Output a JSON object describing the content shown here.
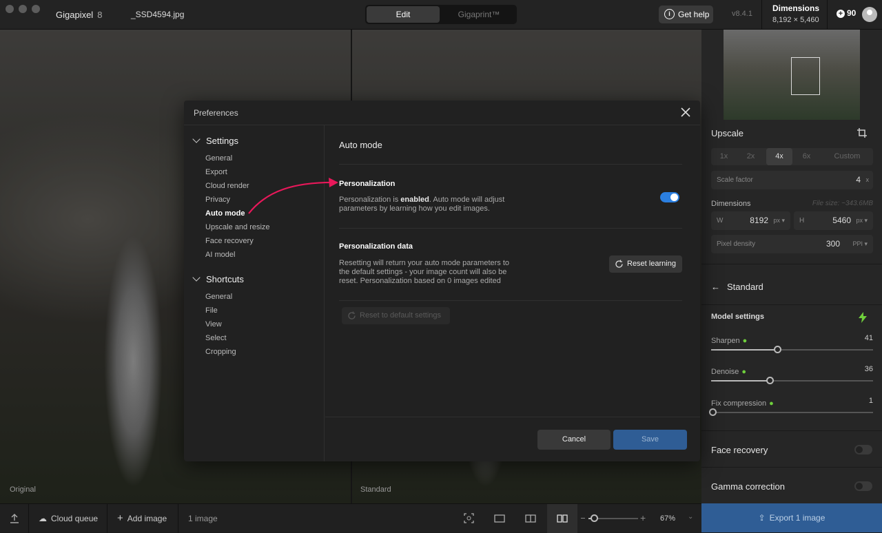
{
  "titlebar": {
    "app_name": "Gigapixel",
    "app_version": "8",
    "file_name": "_SSD4594.jpg",
    "tabs": [
      "Edit",
      "Gigaprint™"
    ],
    "help_label": "Get help",
    "version": "v8.4.1",
    "dimensions_label": "Dimensions",
    "dimensions_value": "8,192 × 5,460",
    "credits": "90"
  },
  "viewer": {
    "left_label": "Original",
    "right_label": "Standard"
  },
  "right_panel": {
    "upscale_title": "Upscale",
    "scale_options": [
      "1x",
      "2x",
      "4x",
      "6x",
      "Custom"
    ],
    "scale_selected": "4x",
    "scale_factor_label": "Scale factor",
    "scale_factor_value": "4",
    "scale_factor_unit": "x",
    "dimensions_title": "Dimensions",
    "file_size": "File size: ~343.6MB",
    "width_label": "W",
    "width_value": "8192",
    "height_label": "H",
    "height_value": "5460",
    "px_unit": "px",
    "density_label": "Pixel density",
    "density_value": "300",
    "density_unit": "PPI",
    "model_name": "Standard",
    "model_settings_title": "Model settings",
    "sliders": [
      {
        "label": "Sharpen",
        "value": "41",
        "fraction": 0.41
      },
      {
        "label": "Denoise",
        "value": "36",
        "fraction": 0.36
      },
      {
        "label": "Fix compression",
        "value": "1",
        "fraction": 0.01
      }
    ],
    "face_recovery": "Face recovery",
    "gamma_correction": "Gamma correction",
    "export_label": "Export 1 image"
  },
  "bottombar": {
    "cloud_queue": "Cloud queue",
    "add_image": "Add image",
    "image_count": "1 image",
    "zoom": "67%"
  },
  "modal": {
    "title": "Preferences",
    "nav": {
      "settings_label": "Settings",
      "settings_items": [
        "General",
        "Export",
        "Cloud render",
        "Privacy",
        "Auto mode",
        "Upscale and resize",
        "Face recovery",
        "AI model"
      ],
      "shortcuts_label": "Shortcuts",
      "shortcuts_items": [
        "General",
        "File",
        "View",
        "Select",
        "Cropping"
      ],
      "active": "Auto mode"
    },
    "content": {
      "title": "Auto mode",
      "personalization_title": "Personalization",
      "personalization_desc_pre": "Personalization is ",
      "personalization_desc_bold": "enabled",
      "personalization_desc_post": ". Auto mode will adjust parameters by learning how you edit images.",
      "personalization_enabled": true,
      "data_title": "Personalization data",
      "data_desc": "Resetting will return your auto mode parameters to the default settings - your image count will also be reset. Personalization based on 0 images edited",
      "reset_learning": "Reset learning",
      "reset_default": "Reset to default settings"
    },
    "cancel_label": "Cancel",
    "save_label": "Save"
  },
  "colors": {
    "accent_blue": "#2b7fe0",
    "export_blue": "#2f5d95",
    "annotation_arrow": "#e8185a",
    "indicator_green": "#6fcf3c"
  }
}
